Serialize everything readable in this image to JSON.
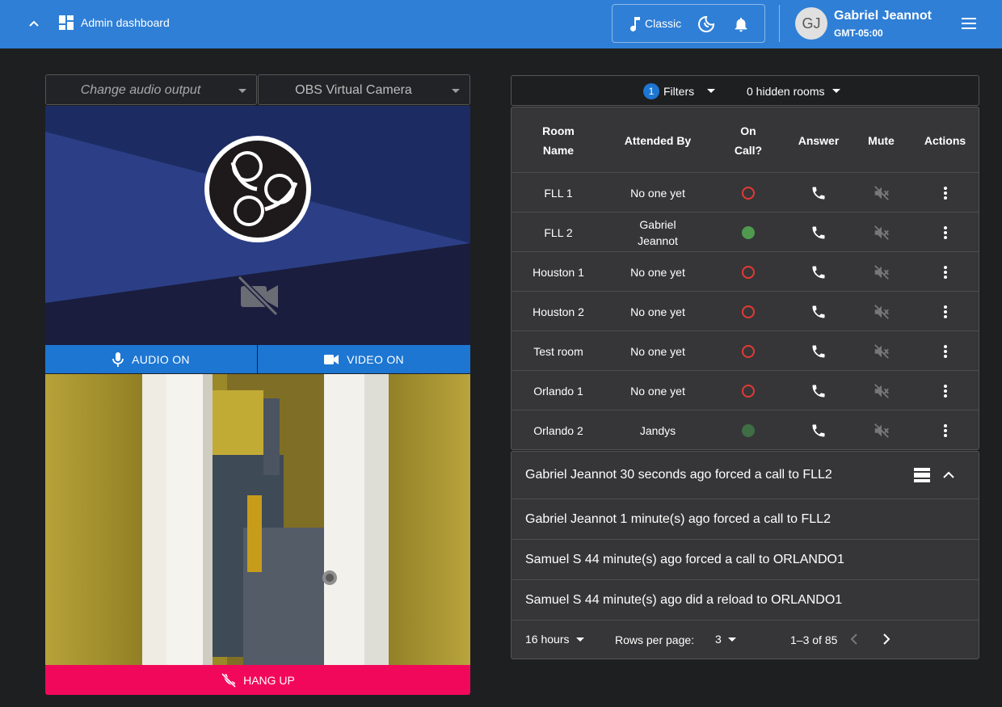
{
  "topbar": {
    "title": "Admin dashboard",
    "theme_label": "Classic",
    "user_initials": "GJ",
    "user_name": "Gabriel Jeannot",
    "timezone": "GMT-05:00"
  },
  "left": {
    "audio_output_placeholder": "Change audio output",
    "camera_select_value": "OBS Virtual Camera",
    "audio_button": "AUDIO ON",
    "video_button": "VIDEO ON",
    "hangup_button": "HANG UP"
  },
  "filters": {
    "count": "1",
    "label": "Filters",
    "hidden_rooms": "0 hidden rooms"
  },
  "table": {
    "headers": {
      "room_name": "Room Name",
      "attended_by": "Attended By",
      "on_call": "On Call?",
      "answer": "Answer",
      "mute": "Mute",
      "actions": "Actions"
    },
    "rows": [
      {
        "room": "FLL 1",
        "attended": "No one yet",
        "on_call": false
      },
      {
        "room": "FLL 2",
        "attended": "Gabriel Jeannot",
        "on_call": true
      },
      {
        "room": "Houston 1",
        "attended": "No one yet",
        "on_call": false
      },
      {
        "room": "Houston 2",
        "attended": "No one yet",
        "on_call": false
      },
      {
        "room": "Test room",
        "attended": "No one yet",
        "on_call": false
      },
      {
        "room": "Orlando 1",
        "attended": "No one yet",
        "on_call": false
      },
      {
        "room": "Orlando 2",
        "attended": "Jandys",
        "on_call": true
      }
    ]
  },
  "log": {
    "latest": "Gabriel Jeannot 30 seconds ago forced a call to FLL2",
    "items": [
      "Gabriel Jeannot 1 minute(s) ago forced a call to FLL2",
      "Samuel S 44 minute(s) ago forced a call to ORLANDO1",
      "Samuel S 44 minute(s) ago did a reload to ORLANDO1"
    ],
    "time_window": "16 hours",
    "rows_per_page_label": "Rows per page:",
    "rows_per_page": "3",
    "range": "1–3 of 85"
  },
  "colors": {
    "topbar": "#2f7fd6",
    "primary_button": "#1d76d2",
    "hangup": "#f2085a",
    "on_call_active": "#4f9a4f",
    "on_call_inactive": "#e53935"
  }
}
